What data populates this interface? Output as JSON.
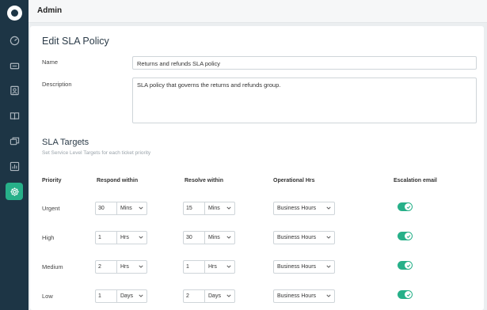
{
  "header": {
    "title": "Admin"
  },
  "sidebar": {
    "items": [
      {
        "icon": "dashboard-icon"
      },
      {
        "icon": "tickets-icon"
      },
      {
        "icon": "contacts-icon"
      },
      {
        "icon": "knowledge-base-icon"
      },
      {
        "icon": "forums-icon"
      },
      {
        "icon": "reports-icon"
      },
      {
        "icon": "admin-gear-icon",
        "active": true
      }
    ]
  },
  "page": {
    "title": "Edit SLA Policy"
  },
  "form": {
    "name_label": "Name",
    "name_value": "Returns and refunds SLA policy",
    "description_label": "Description",
    "description_value": "SLA policy that governs the returns and refunds group."
  },
  "sla_targets": {
    "title": "SLA Targets",
    "subtitle": "Set Service Level Targets for each ticket priority",
    "columns": [
      "Priority",
      "Respond within",
      "Resolve within",
      "Operational Hrs",
      "Escalation email"
    ],
    "rows": [
      {
        "priority": "Urgent",
        "respond_value": "30",
        "respond_unit": "Mins",
        "resolve_value": "15",
        "resolve_unit": "Mins",
        "hours": "Business Hours",
        "escalation": true
      },
      {
        "priority": "High",
        "respond_value": "1",
        "respond_unit": "Hrs",
        "resolve_value": "30",
        "resolve_unit": "Mins",
        "hours": "Business Hours",
        "escalation": true
      },
      {
        "priority": "Medium",
        "respond_value": "2",
        "respond_unit": "Hrs",
        "resolve_value": "1",
        "resolve_unit": "Hrs",
        "hours": "Business Hours",
        "escalation": true
      },
      {
        "priority": "Low",
        "respond_value": "1",
        "respond_unit": "Days",
        "resolve_value": "2",
        "resolve_unit": "Days",
        "hours": "Business Hours",
        "escalation": true
      }
    ]
  },
  "colors": {
    "sidebar": "#1d3545",
    "accent": "#27b089"
  }
}
